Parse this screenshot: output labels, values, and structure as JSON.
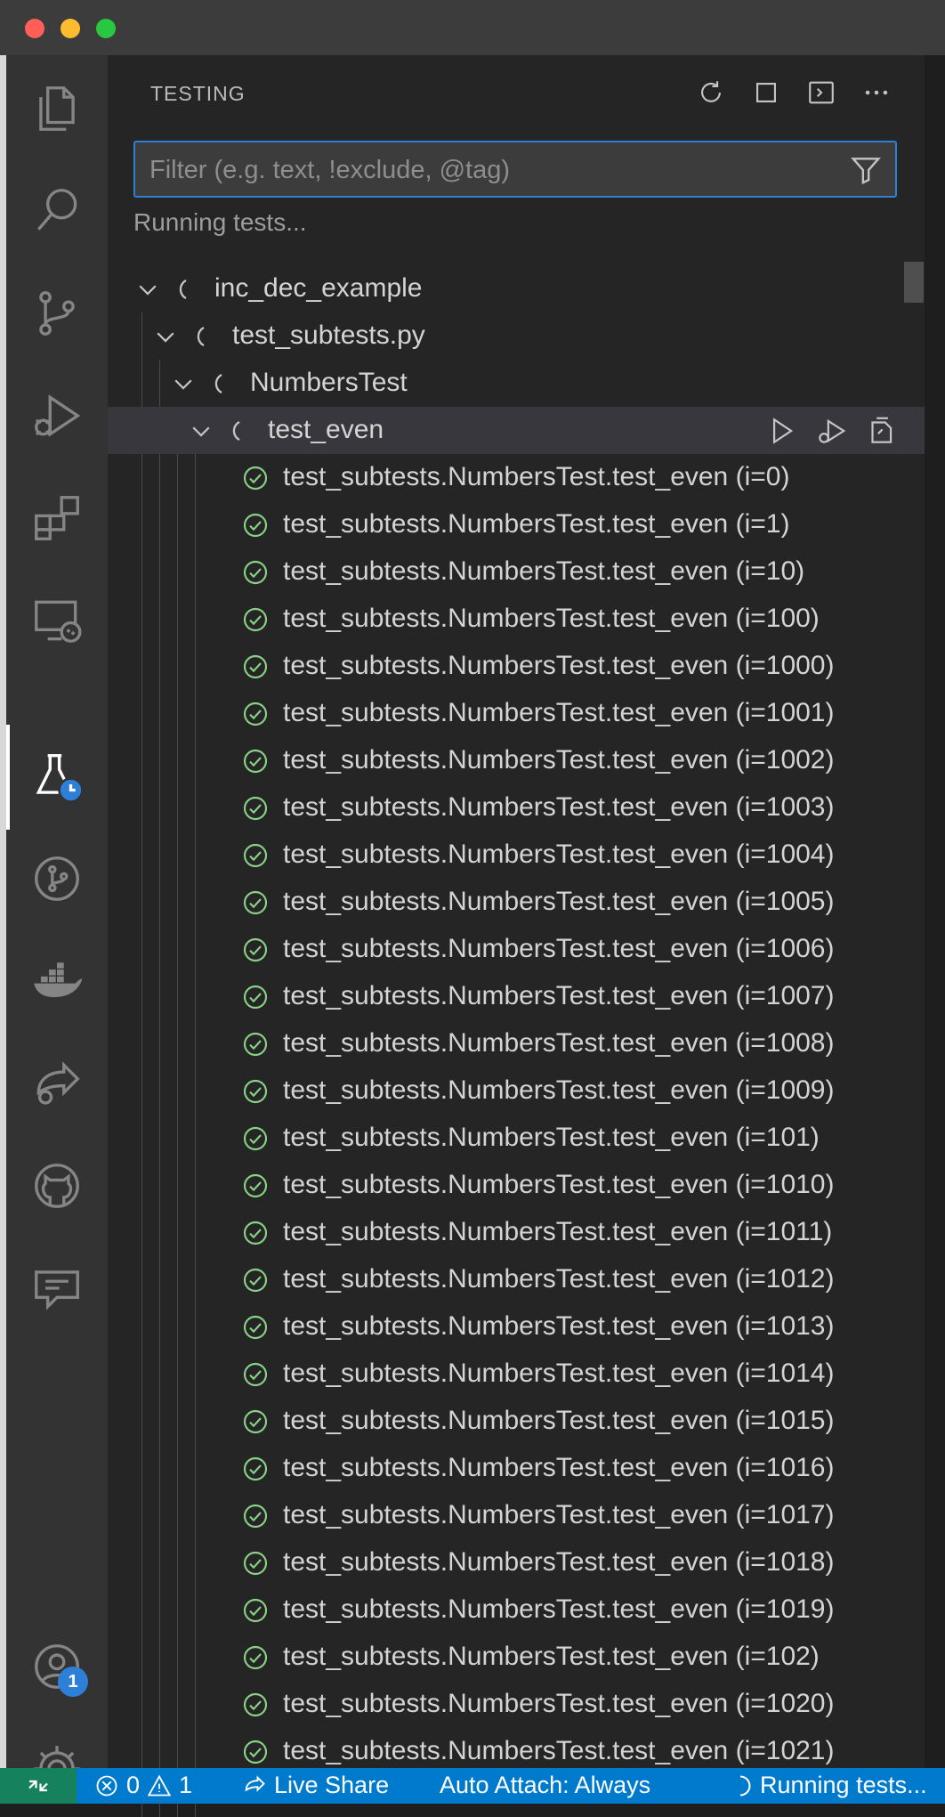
{
  "panel": {
    "title": "TESTING",
    "filter_placeholder": "Filter (e.g. text, !exclude, @tag)",
    "status_message": "Running tests..."
  },
  "tree": {
    "root": "inc_dec_example",
    "file": "test_subtests.py",
    "class": "NumbersTest",
    "method": "test_even",
    "subtests": [
      "test_subtests.NumbersTest.test_even (i=0)",
      "test_subtests.NumbersTest.test_even (i=1)",
      "test_subtests.NumbersTest.test_even (i=10)",
      "test_subtests.NumbersTest.test_even (i=100)",
      "test_subtests.NumbersTest.test_even (i=1000)",
      "test_subtests.NumbersTest.test_even (i=1001)",
      "test_subtests.NumbersTest.test_even (i=1002)",
      "test_subtests.NumbersTest.test_even (i=1003)",
      "test_subtests.NumbersTest.test_even (i=1004)",
      "test_subtests.NumbersTest.test_even (i=1005)",
      "test_subtests.NumbersTest.test_even (i=1006)",
      "test_subtests.NumbersTest.test_even (i=1007)",
      "test_subtests.NumbersTest.test_even (i=1008)",
      "test_subtests.NumbersTest.test_even (i=1009)",
      "test_subtests.NumbersTest.test_even (i=101)",
      "test_subtests.NumbersTest.test_even (i=1010)",
      "test_subtests.NumbersTest.test_even (i=1011)",
      "test_subtests.NumbersTest.test_even (i=1012)",
      "test_subtests.NumbersTest.test_even (i=1013)",
      "test_subtests.NumbersTest.test_even (i=1014)",
      "test_subtests.NumbersTest.test_even (i=1015)",
      "test_subtests.NumbersTest.test_even (i=1016)",
      "test_subtests.NumbersTest.test_even (i=1017)",
      "test_subtests.NumbersTest.test_even (i=1018)",
      "test_subtests.NumbersTest.test_even (i=1019)",
      "test_subtests.NumbersTest.test_even (i=102)",
      "test_subtests.NumbersTest.test_even (i=1020)",
      "test_subtests.NumbersTest.test_even (i=1021)"
    ]
  },
  "activity_bar": {
    "icons": [
      "files-icon",
      "search-icon",
      "source-control-icon",
      "run-debug-icon",
      "extensions-icon",
      "remote-explorer-icon",
      "testing-icon",
      "git-graph-icon",
      "docker-icon",
      "live-share-icon",
      "github-icon",
      "comments-icon",
      "accounts-icon",
      "settings-icon"
    ],
    "accounts_badge": "1"
  },
  "status_bar": {
    "errors": "0",
    "warnings": "1",
    "live_share": "Live Share",
    "auto_attach": "Auto Attach: Always",
    "running": "Running tests..."
  },
  "colors": {
    "accent": "#007acc",
    "pass": "#89d185",
    "remote": "#16825d"
  }
}
